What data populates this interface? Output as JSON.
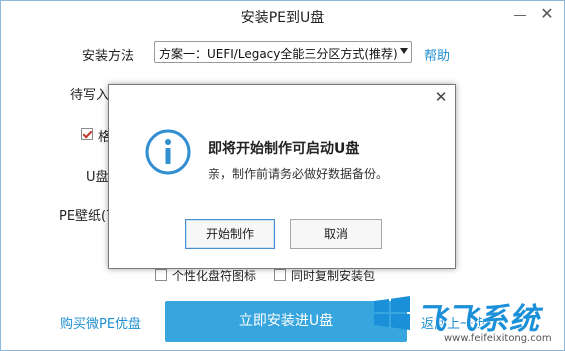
{
  "window": {
    "title": "安装PE到U盘",
    "minimize_icon": "minimize-icon",
    "close_icon": "close-icon"
  },
  "form": {
    "install_method_label": "安装方法",
    "install_method_value": "方案一：UEFI/Legacy全能三分区方式(推荐)",
    "help_link": "帮助",
    "pending_label": "待写入",
    "format_label": "格",
    "format_checked": true,
    "udisk_label": "U盘",
    "wallpaper_label": "PE壁纸(可",
    "personalize_label": "个性化盘符图标",
    "copy_package_label": "同时复制安装包"
  },
  "footer": {
    "buy_link": "购买微PE优盘",
    "install_button": "立即安装进U盘",
    "back_link": "返回上一步"
  },
  "dialog": {
    "title": "即将开始制作可启动U盘",
    "message": "亲，制作前请务必做好数据备份。",
    "start_button": "开始制作",
    "cancel_button": "取消",
    "icon": "info-icon",
    "close_icon": "close-icon"
  },
  "watermark": {
    "brand_text": "飞飞系统",
    "url": "www.feifeixitong.com"
  },
  "colors": {
    "accent": "#37a5de",
    "link": "#1e8fd0",
    "brand": "#1a90d8"
  }
}
